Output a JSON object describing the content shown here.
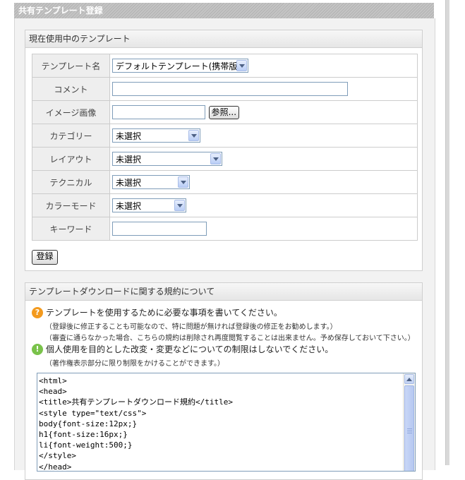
{
  "page": {
    "title": "共有テンプレート登録"
  },
  "current_template": {
    "heading": "現在使用中のテンプレート",
    "rows": [
      {
        "label": "テンプレート名",
        "type": "select",
        "value": "デフォルトテンプレート(携帯版)"
      },
      {
        "label": "コメント",
        "type": "text",
        "value": ""
      },
      {
        "label": "イメージ画像",
        "type": "file",
        "value": "",
        "browse_label": "参照..."
      },
      {
        "label": "カテゴリー",
        "type": "select",
        "value": "未選択"
      },
      {
        "label": "レイアウト",
        "type": "select",
        "value": "未選択"
      },
      {
        "label": "テクニカル",
        "type": "select",
        "value": "未選択"
      },
      {
        "label": "カラーモード",
        "type": "select",
        "value": "未選択"
      },
      {
        "label": "キーワード",
        "type": "text",
        "value": ""
      }
    ],
    "submit_label": "登録"
  },
  "terms": {
    "heading": "テンプレートダウンロードに関する規約について",
    "notes": [
      {
        "icon": "question-icon",
        "color": "#f39a1e",
        "text": "テンプレートを使用するために必要な事項を書いてください。",
        "sub": [
          "（登録後に修正することも可能なので、特に問題が無ければ登録後の修正をお勧めします。）",
          "（審査に通らなかった場合、こちらの規約は削除され再度閲覧することは出来ません。予め保存しておいて下さい。）"
        ]
      },
      {
        "icon": "exclamation-icon",
        "color": "#79c24a",
        "text": "個人使用を目的とした改変・変更などについての制限はしないでください。",
        "sub": [
          "（著作権表示部分に限り制限をかけることができます。）"
        ]
      }
    ],
    "code": "<html>\n<head>\n<title>共有テンプレートダウンロード規約</title>\n<style type=\"text/css\">\nbody{font-size:12px;}\nh1{font-size:16px;}\nli{font-weight:500;}\n</style>\n</head>"
  }
}
